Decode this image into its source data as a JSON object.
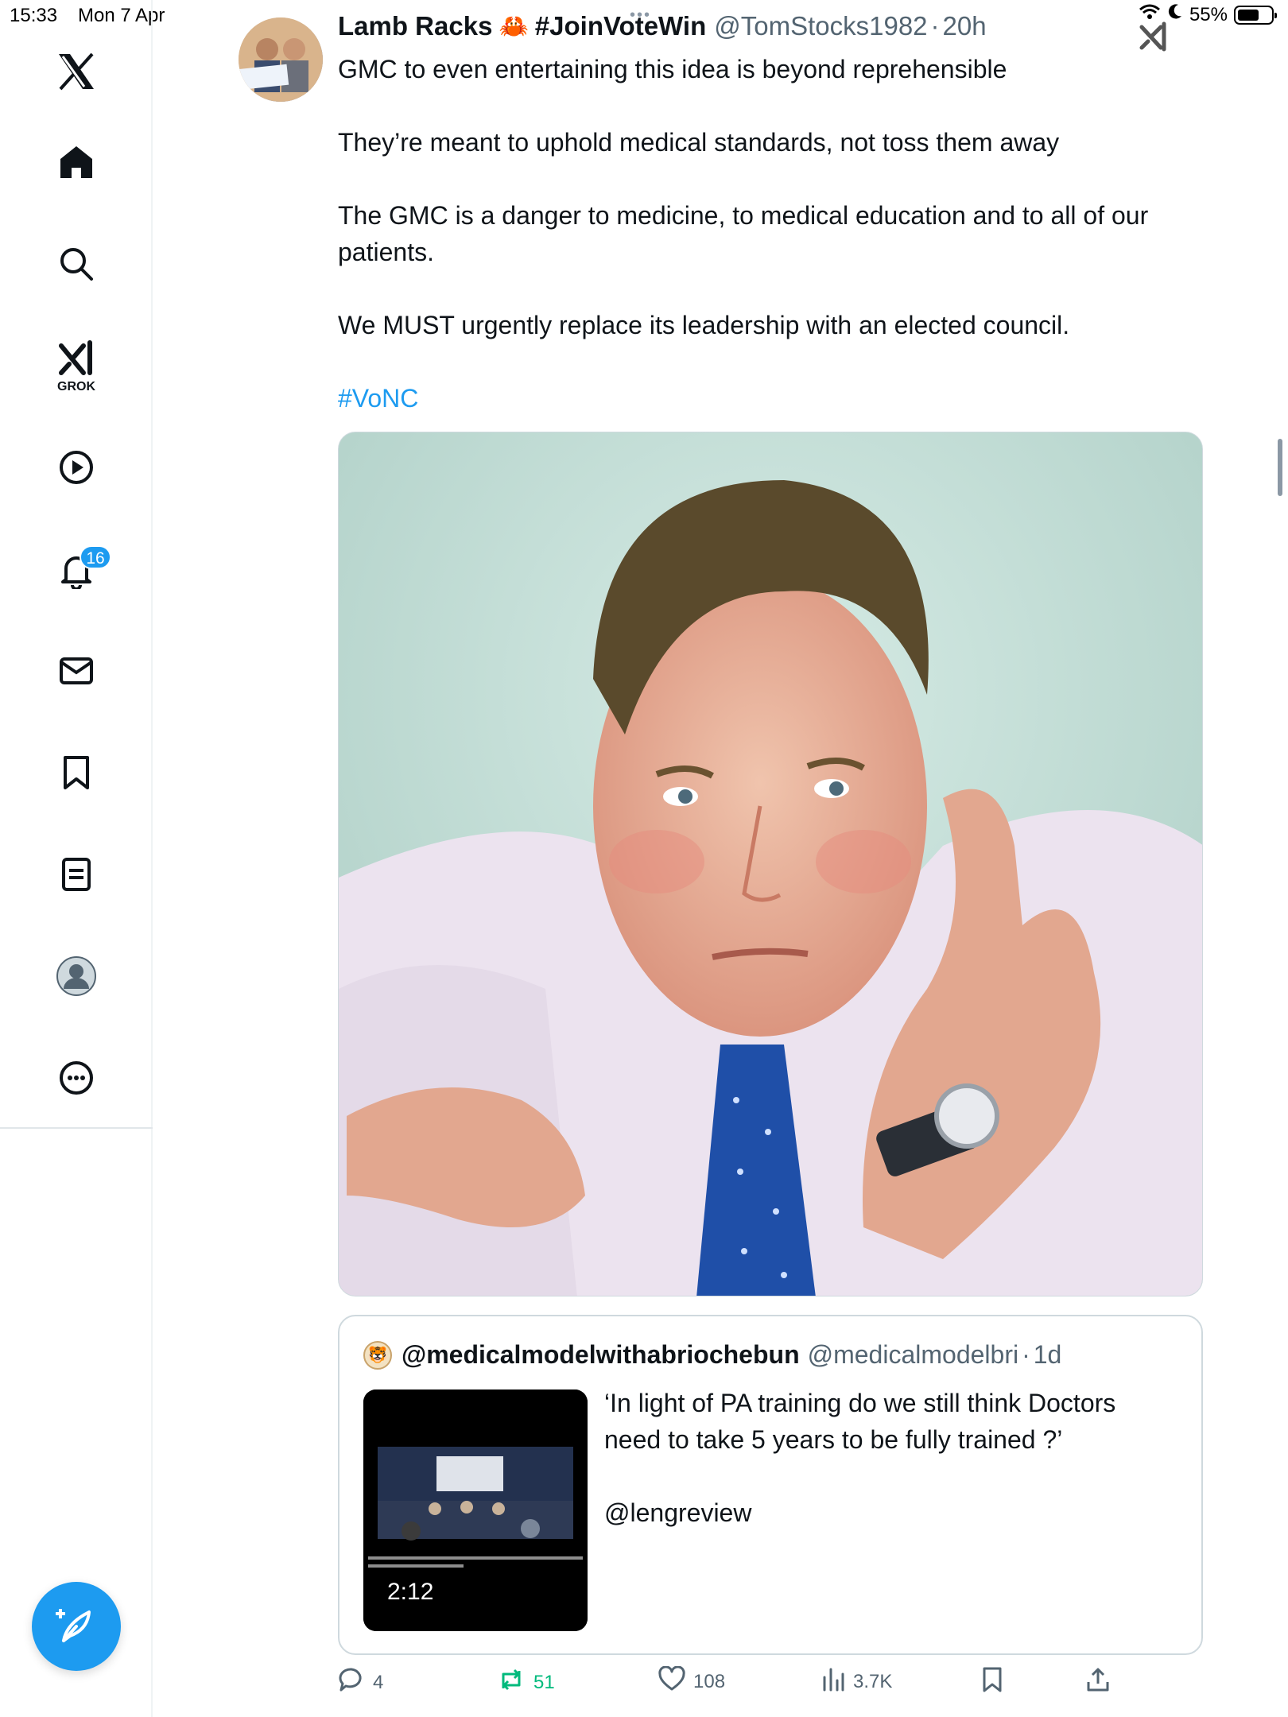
{
  "status_bar": {
    "time": "15:33",
    "date": "Mon 7 Apr",
    "battery": "55%",
    "battery_level": 0.55
  },
  "sidebar": {
    "grok_label": "GROK",
    "notifications_badge": "16",
    "items": [
      "x-logo",
      "home-icon",
      "search-icon",
      "grok-icon",
      "video-icon",
      "bell-icon",
      "mail-icon",
      "bookmark-icon",
      "lists-icon",
      "profile-icon",
      "more-icon"
    ]
  },
  "tweet": {
    "author": "Lamb Racks",
    "emoji": "🦀",
    "tag": "#JoinVoteWin",
    "handle": "@TomStocks1982",
    "separator": "·",
    "time": "20h",
    "paragraphs": [
      "GMC to even entertaining this idea is beyond reprehensible",
      "They’re meant to uphold medical standards, not toss them away",
      "The GMC is a danger to medicine, to medical education and to all of our patients.",
      "We MUST urgently replace its leadership with an elected council."
    ],
    "hashtag": "#VoNC"
  },
  "quote": {
    "name": "@medicalmodelwithabriochebun",
    "handle": "@medicalmodelbri",
    "separator": "·",
    "time": "1d",
    "text": "‘In light of PA training do we still think Doctors need to take 5 years to be fully trained ?’",
    "mention": "@lengreview",
    "video_duration": "2:12"
  },
  "actions": {
    "replies": "4",
    "reposts": "51",
    "likes": "108",
    "views": "3.7K"
  },
  "colors": {
    "accent": "#1d9bf0",
    "repost": "#00ba7c",
    "muted": "#536471"
  }
}
